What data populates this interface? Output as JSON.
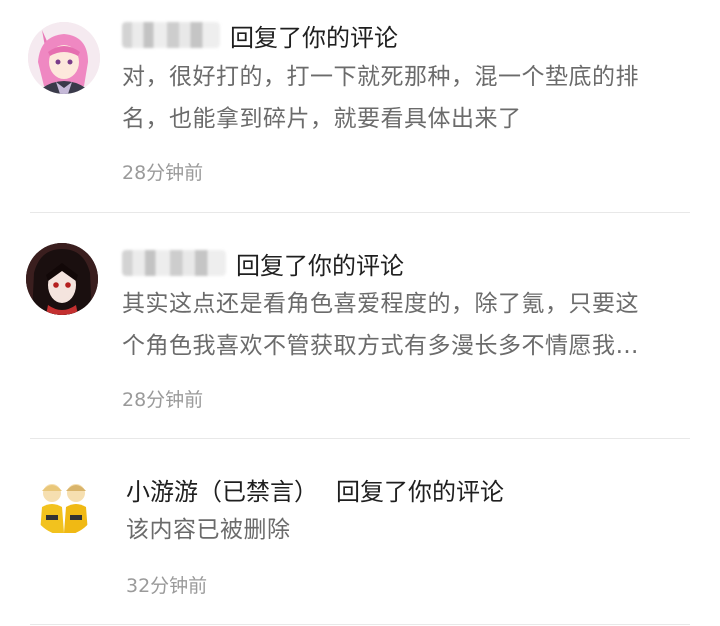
{
  "notifications": [
    {
      "username": "",
      "action": "回复了你的评论",
      "content_lines": [
        "对，很好打的，打一下就死那种，混一个垫底的排",
        "名，也能拿到碎片，就要看具体出来了"
      ],
      "time": "28分钟前",
      "avatar_icon": "pink-hair-anime-avatar"
    },
    {
      "username": "",
      "action": "回复了你的评论",
      "content_lines": [
        "其实这点还是看角色喜爱程度的，除了氪，只要这",
        "个角色我喜欢不管获取方式有多漫长多不情愿我…"
      ],
      "time": "28分钟前",
      "avatar_icon": "dark-hair-anime-avatar"
    },
    {
      "username": "小游游（已禁言）",
      "action": "回复了你的评论",
      "content_lines": [
        "该内容已被删除"
      ],
      "time": "32分钟前",
      "avatar_icon": "yellow-characters-avatar"
    }
  ]
}
